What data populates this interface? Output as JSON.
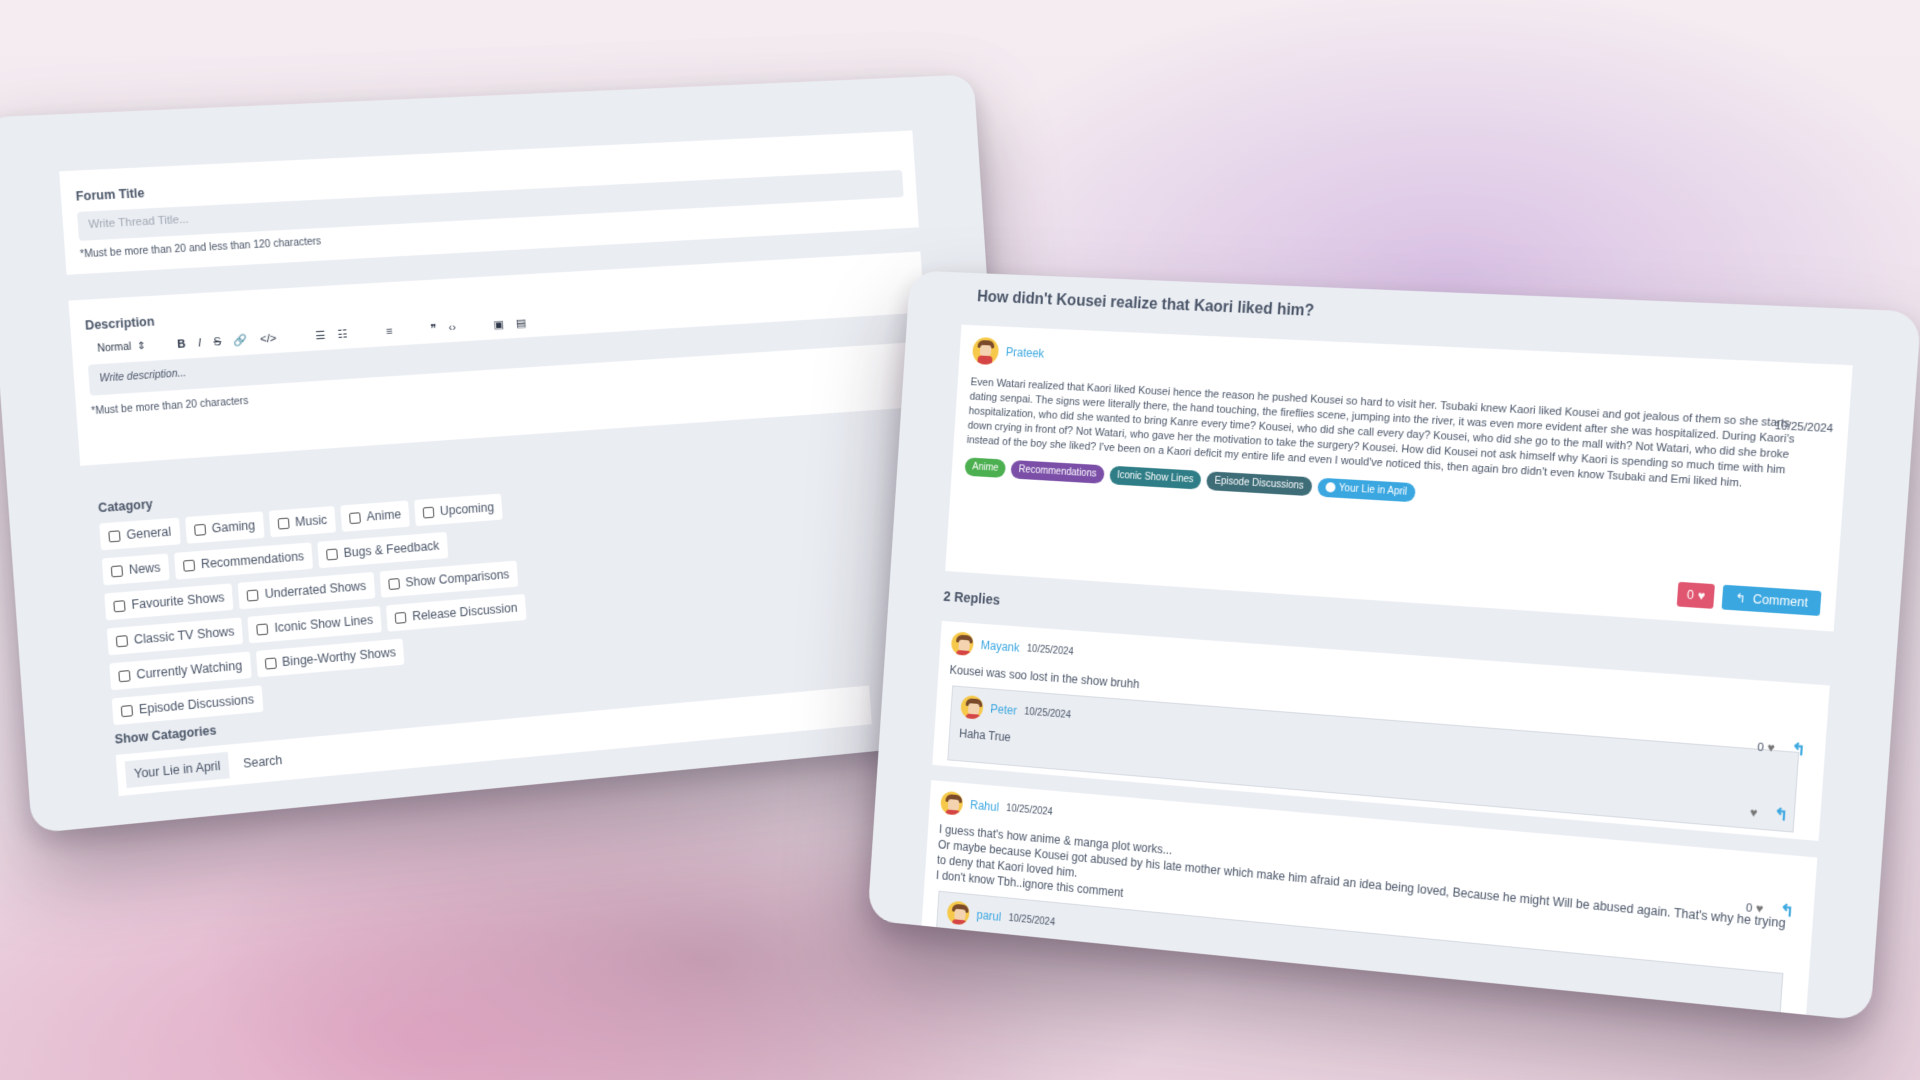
{
  "form": {
    "forum_title_label": "Forum Title",
    "title_placeholder": "Write Thread Title...",
    "title_hint": "*Must be more than 20 and less than 120 characters",
    "description_label": "Description",
    "toolbar_select": "Normal",
    "toolbar_icons": [
      "bold-icon",
      "italic-icon",
      "strike-icon",
      "link-icon",
      "code-icon",
      "ordered-list-icon",
      "bullet-list-icon",
      "align-icon",
      "quote-icon",
      "code-block-icon",
      "image-icon",
      "video-icon"
    ],
    "description_placeholder": "Write description...",
    "description_hint": "*Must be more than 20 characters",
    "category_label": "Catagory",
    "categories": [
      "General",
      "Gaming",
      "Music",
      "Anime",
      "Upcoming",
      "News",
      "Recommendations",
      "Bugs & Feedback",
      "Favourite Shows",
      "Underrated Shows",
      "Show Comparisons",
      "Classic TV Shows",
      "Iconic Show Lines",
      "Release Discussion",
      "Currently Watching",
      "Binge-Worthy Shows",
      "Episode Discussions"
    ],
    "show_categories_label": "Show Catagories",
    "show_tag": "Your Lie in April",
    "show_search": "Search"
  },
  "thread": {
    "title": "How didn't Kousei realize that Kaori liked him?",
    "author": "Prateek",
    "date": "10/25/2024",
    "body": "Even Watari realized that Kaori liked Kousei hence the reason he pushed Kousei so hard to visit her. Tsubaki knew Kaori liked Kousei and got jealous of them so she starts dating senpai. The signs were literally there, the hand touching, the fireflies scene, jumping into the river, it was even more evident after she was hospitalized. During Kaori's hospitalization, who did she wanted to bring Kanre every time? Kousei, who did she call every day? Kousei, who did she go to the mall with? Not Watari, who did she broke down crying in front of? Not Watari, who gave her the motivation to take the surgery? Kousei. How did Kousei not ask himself why Kaori is spending so much time with him instead of the boy she liked? I've been on a Kaori deficit my entire life and even I would've noticed this, then again bro didn't even know Tsubaki and Emi liked him.",
    "tags": [
      {
        "label": "Anime",
        "color": "#4caf50"
      },
      {
        "label": "Recommendations",
        "color": "#7b4fa8"
      },
      {
        "label": "Iconic Show Lines",
        "color": "#2f7d86"
      },
      {
        "label": "Episode Discussions",
        "color": "#3e6d78"
      },
      {
        "label": "Your Lie in April",
        "color": "#3ba7e0"
      }
    ],
    "likes": "0",
    "comment_label": "Comment"
  },
  "replies_count": "2 Replies",
  "replies": [
    {
      "author": "Mayank",
      "date": "10/25/2024",
      "text": "Kousei was soo lost in the show bruhh",
      "likes": "0",
      "nested": {
        "author": "Peter",
        "date": "10/25/2024",
        "text": "Haha True"
      }
    },
    {
      "author": "Rahul",
      "date": "10/25/2024",
      "lines": [
        "I guess that's how anime & manga plot works...",
        "Or maybe because Kousei got abused by his late mother which make him afraid an idea being loved, Because he might Will be abused again. That's why he trying",
        "to deny that Kaori loved him.",
        "I don't know Tbh..ignore this comment"
      ],
      "likes": "0",
      "nested": {
        "author": "parul",
        "date": "10/25/2024"
      }
    }
  ]
}
